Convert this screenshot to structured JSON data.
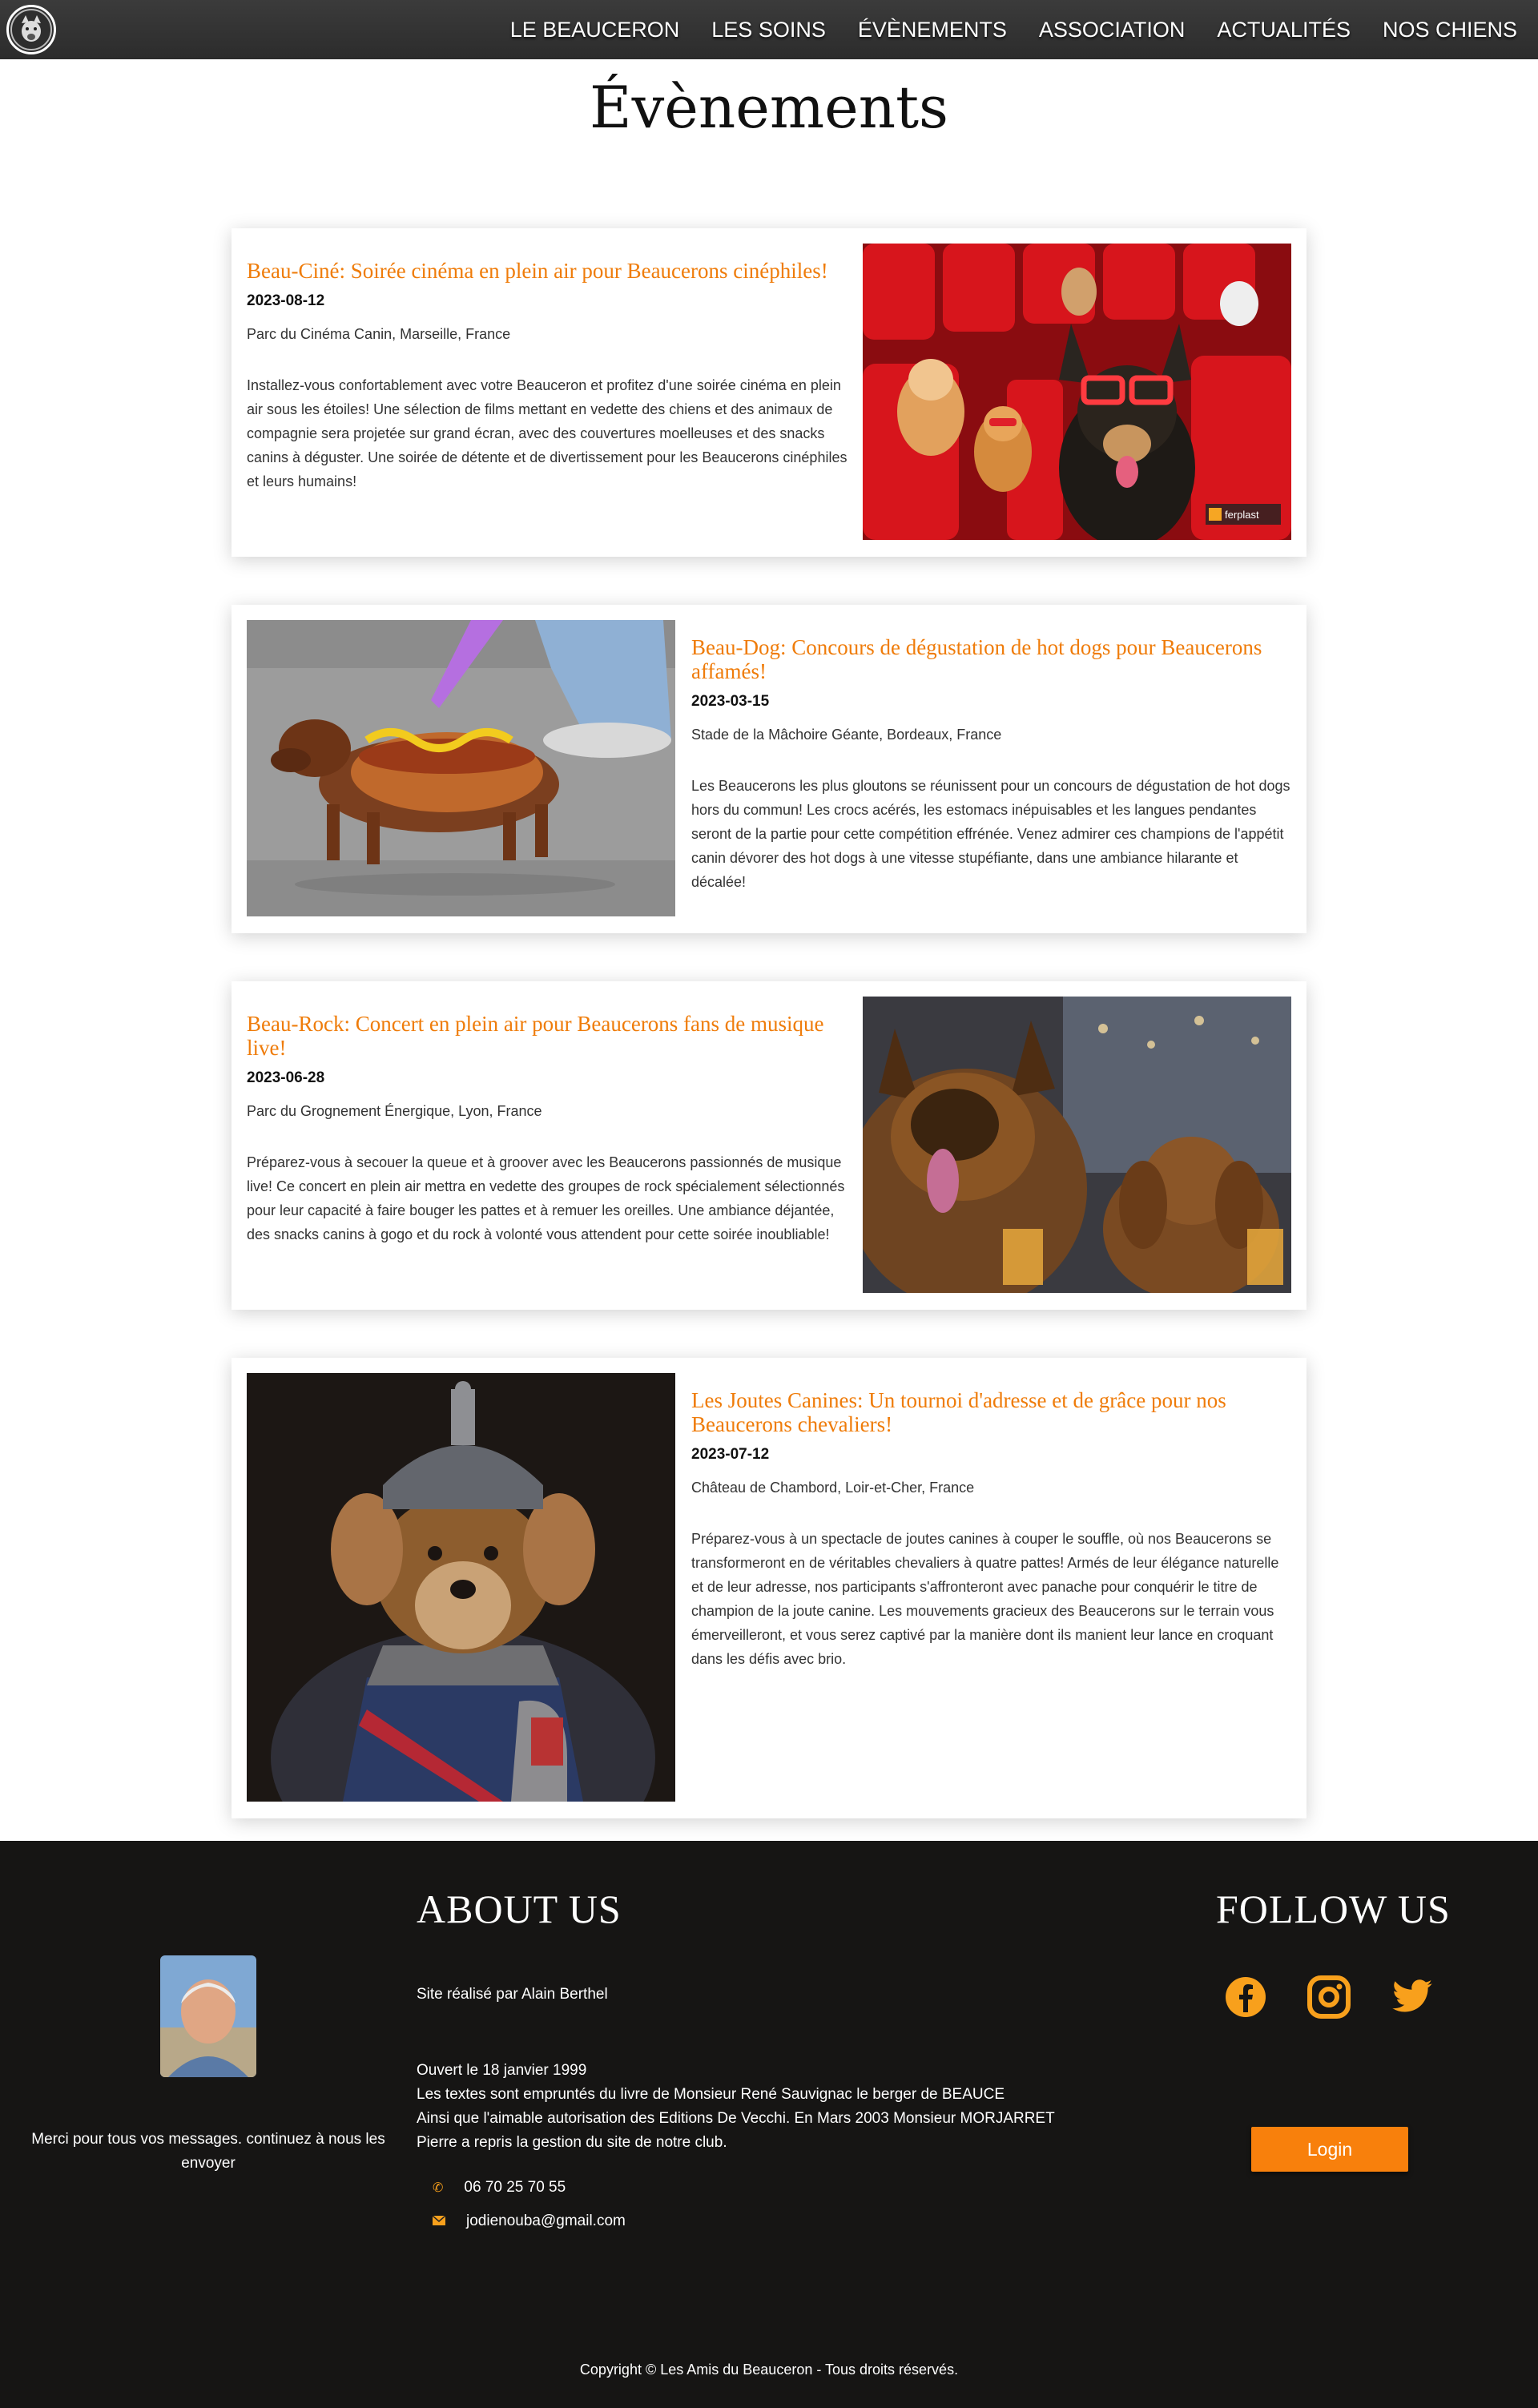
{
  "nav": {
    "items": [
      "LE BEAUCERON",
      "LES SOINS",
      "ÉVÈNEMENTS",
      "ASSOCIATION",
      "ACTUALITÉS",
      "NOS CHIENS"
    ]
  },
  "page": {
    "title": "Évènements"
  },
  "events": [
    {
      "title": "Beau-Ciné: Soirée cinéma en plein air pour Beaucerons cinéphiles!",
      "date": "2023-08-12",
      "place": "Parc du Cinéma Canin, Marseille, France",
      "description": "Installez-vous confortablement avec votre Beauceron et profitez d'une soirée cinéma en plein air sous les étoiles! Une sélection de films mettant en vedette des chiens et des animaux de compagnie sera projetée sur grand écran, avec des couvertures moelleuses et des snacks canins à déguster. Une soirée de détente et de divertissement pour les Beaucerons cinéphiles et leurs humains!",
      "image_watermark": "ferplast"
    },
    {
      "title": "Beau-Dog: Concours de dégustation de hot dogs pour Beaucerons affamés!",
      "date": "2023-03-15",
      "place": "Stade de la Mâchoire Géante, Bordeaux, France",
      "description": "Les Beaucerons les plus gloutons se réunissent pour un concours de dégustation de hot dogs hors du commun! Les crocs acérés, les estomacs inépuisables et les langues pendantes seront de la partie pour cette compétition effrénée. Venez admirer ces champions de l'appétit canin dévorer des hot dogs à une vitesse stupéfiante, dans une ambiance hilarante et décalée!"
    },
    {
      "title": "Beau-Rock: Concert en plein air pour Beaucerons fans de musique live!",
      "date": "2023-06-28",
      "place": "Parc du Grognement Énergique, Lyon, France",
      "description": "Préparez-vous à secouer la queue et à groover avec les Beaucerons passionnés de musique live! Ce concert en plein air mettra en vedette des groupes de rock spécialement sélectionnés pour leur capacité à faire bouger les pattes et à remuer les oreilles. Une ambiance déjantée, des snacks canins à gogo et du rock à volonté vous attendent pour cette soirée inoubliable!"
    },
    {
      "title": "Les Joutes Canines: Un tournoi d'adresse et de grâce pour nos Beaucerons chevaliers!",
      "date": "2023-07-12",
      "place": "Château de Chambord, Loir-et-Cher, France",
      "description": "Préparez-vous à un spectacle de joutes canines à couper le souffle, où nos Beaucerons se transformeront en de véritables chevaliers à quatre pattes! Armés de leur élégance naturelle et de leur adresse, nos participants s'affronteront avec panache pour conquérir le titre de champion de la joute canine. Les mouvements gracieux des Beaucerons sur le terrain vous émerveilleront, et vous serez captivé par la manière dont ils manient leur lance en croquant dans les défis avec brio."
    }
  ],
  "footer": {
    "about_heading": "ABOUT US",
    "follow_heading": "FOLLOW US",
    "thanks": "Merci pour tous vos messages. continuez à nous les envoyer",
    "credit": "Site réalisé par Alain Berthel",
    "about_lines": [
      "Ouvert le 18 janvier 1999",
      "Les textes sont empruntés du livre de Monsieur René Sauvignac le berger de BEAUCE",
      "Ainsi que l'aimable autorisation des Editions De Vecchi. En Mars 2003 Monsieur MORJARRET",
      "Pierre a repris la gestion du site de notre club."
    ],
    "phone": "06 70 25 70 55",
    "email": "jodienouba@gmail.com",
    "login_label": "Login",
    "copyright": "Copyright © Les Amis du Beauceron - Tous droits réservés.",
    "social": [
      "facebook-icon",
      "instagram-icon",
      "twitter-icon"
    ],
    "accent_color": "#f8800c"
  },
  "colors": {
    "nav_bg": "#333333",
    "event_title": "#ef7c0a",
    "footer_bg": "#161514"
  }
}
